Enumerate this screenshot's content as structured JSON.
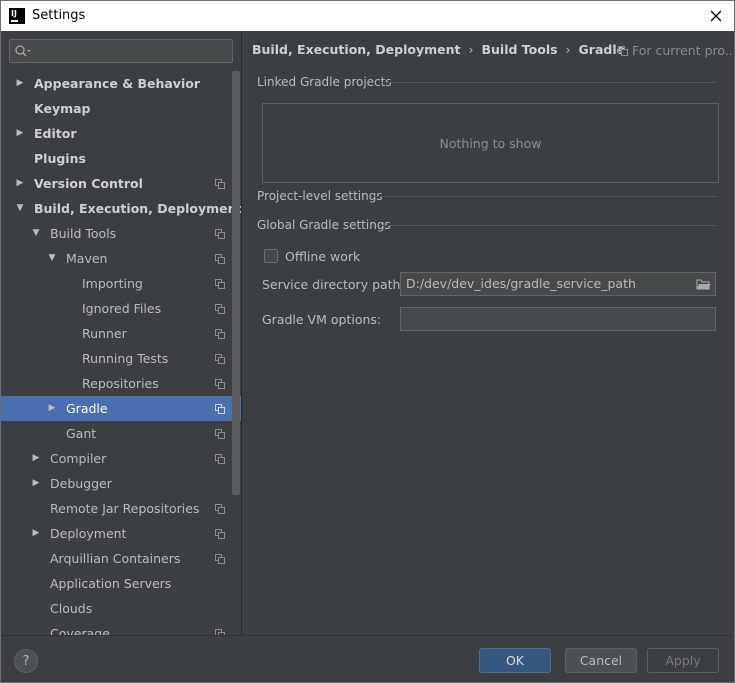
{
  "window": {
    "title": "Settings",
    "logo_text": "IJ"
  },
  "sidebar": {
    "search": {
      "value": "",
      "placeholder": ""
    },
    "items": [
      {
        "label": "Appearance & Behavior",
        "level": 0,
        "expandable": true,
        "expanded": false,
        "bold": true,
        "copy_icon": false
      },
      {
        "label": "Keymap",
        "level": 0,
        "expandable": false,
        "bold": true,
        "copy_icon": false
      },
      {
        "label": "Editor",
        "level": 0,
        "expandable": true,
        "expanded": false,
        "bold": true,
        "copy_icon": false
      },
      {
        "label": "Plugins",
        "level": 0,
        "expandable": false,
        "bold": true,
        "copy_icon": false
      },
      {
        "label": "Version Control",
        "level": 0,
        "expandable": true,
        "expanded": false,
        "bold": true,
        "copy_icon": true
      },
      {
        "label": "Build, Execution, Deployment",
        "level": 0,
        "expandable": true,
        "expanded": true,
        "bold": true,
        "copy_icon": false
      },
      {
        "label": "Build Tools",
        "level": 1,
        "expandable": true,
        "expanded": true,
        "bold": false,
        "copy_icon": true
      },
      {
        "label": "Maven",
        "level": 2,
        "expandable": true,
        "expanded": true,
        "bold": false,
        "copy_icon": true
      },
      {
        "label": "Importing",
        "level": 3,
        "expandable": false,
        "bold": false,
        "copy_icon": true
      },
      {
        "label": "Ignored Files",
        "level": 3,
        "expandable": false,
        "bold": false,
        "copy_icon": true
      },
      {
        "label": "Runner",
        "level": 3,
        "expandable": false,
        "bold": false,
        "copy_icon": true
      },
      {
        "label": "Running Tests",
        "level": 3,
        "expandable": false,
        "bold": false,
        "copy_icon": true
      },
      {
        "label": "Repositories",
        "level": 3,
        "expandable": false,
        "bold": false,
        "copy_icon": true
      },
      {
        "label": "Gradle",
        "level": 2,
        "expandable": true,
        "expanded": false,
        "bold": false,
        "copy_icon": true,
        "selected": true
      },
      {
        "label": "Gant",
        "level": 2,
        "expandable": false,
        "bold": false,
        "copy_icon": true
      },
      {
        "label": "Compiler",
        "level": 1,
        "expandable": true,
        "expanded": false,
        "bold": false,
        "copy_icon": true
      },
      {
        "label": "Debugger",
        "level": 1,
        "expandable": true,
        "expanded": false,
        "bold": false,
        "copy_icon": false
      },
      {
        "label": "Remote Jar Repositories",
        "level": 1,
        "expandable": false,
        "bold": false,
        "copy_icon": true
      },
      {
        "label": "Deployment",
        "level": 1,
        "expandable": true,
        "expanded": false,
        "bold": false,
        "copy_icon": true
      },
      {
        "label": "Arquillian Containers",
        "level": 1,
        "expandable": false,
        "bold": false,
        "copy_icon": true
      },
      {
        "label": "Application Servers",
        "level": 1,
        "expandable": false,
        "bold": false,
        "copy_icon": false
      },
      {
        "label": "Clouds",
        "level": 1,
        "expandable": false,
        "bold": false,
        "copy_icon": false
      },
      {
        "label": "Coverage",
        "level": 1,
        "expandable": false,
        "bold": false,
        "copy_icon": true
      }
    ]
  },
  "content": {
    "breadcrumb": [
      "Build, Execution, Deployment",
      "Build Tools",
      "Gradle"
    ],
    "scope_hint": "For current pro...",
    "linked_projects": {
      "title": "Linked Gradle projects",
      "empty_text": "Nothing to show"
    },
    "project_level": {
      "title": "Project-level settings"
    },
    "global": {
      "title": "Global Gradle settings",
      "offline_work": {
        "label": "Offline work",
        "checked": false
      },
      "service_dir": {
        "label": "Service directory path:",
        "value": "D:/dev/dev_ides/gradle_service_path"
      },
      "vm_options": {
        "label": "Gradle VM options:",
        "value": ""
      }
    }
  },
  "footer": {
    "help_label": "?",
    "ok_label": "OK",
    "cancel_label": "Cancel",
    "apply_label": "Apply"
  },
  "colors": {
    "background": "#3c3f41",
    "selection": "#4b6eaf",
    "ok_button": "#365880",
    "text": "#bbbbbb"
  }
}
